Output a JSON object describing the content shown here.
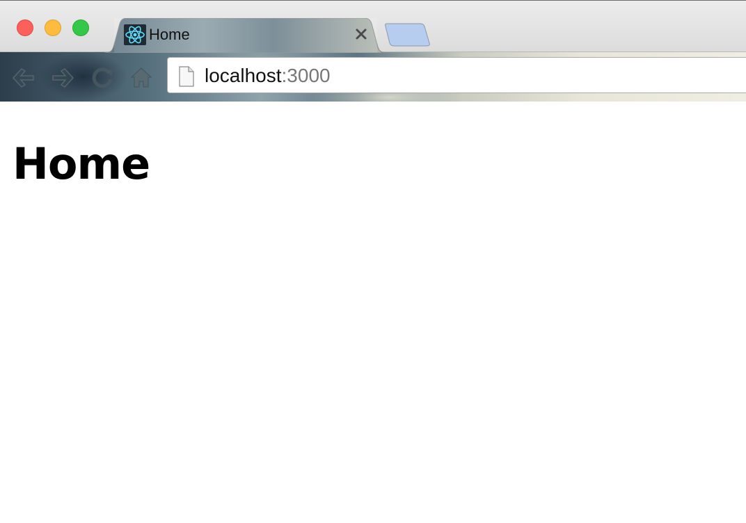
{
  "window": {
    "controls": {
      "close_icon": "close-icon",
      "minimize_icon": "minimize-icon",
      "zoom_icon": "zoom-icon",
      "colors": {
        "close": "#fc605b",
        "minimize": "#fdbc40",
        "zoom": "#34c749"
      }
    }
  },
  "tabs": [
    {
      "title": "Home",
      "favicon": "react-icon",
      "active": true,
      "close_icon": "close-icon"
    }
  ],
  "new_tab": {
    "icon": "new-tab-icon",
    "color": "#b7cdf0"
  },
  "toolbar": {
    "back_icon": "arrow-left-icon",
    "forward_icon": "arrow-right-icon",
    "reload_icon": "reload-icon",
    "home_icon": "home-icon"
  },
  "address_bar": {
    "page_icon": "page-icon",
    "host": "localhost",
    "port": ":3000"
  },
  "page": {
    "heading": "Home"
  },
  "colors": {
    "react": "#61dafb"
  }
}
